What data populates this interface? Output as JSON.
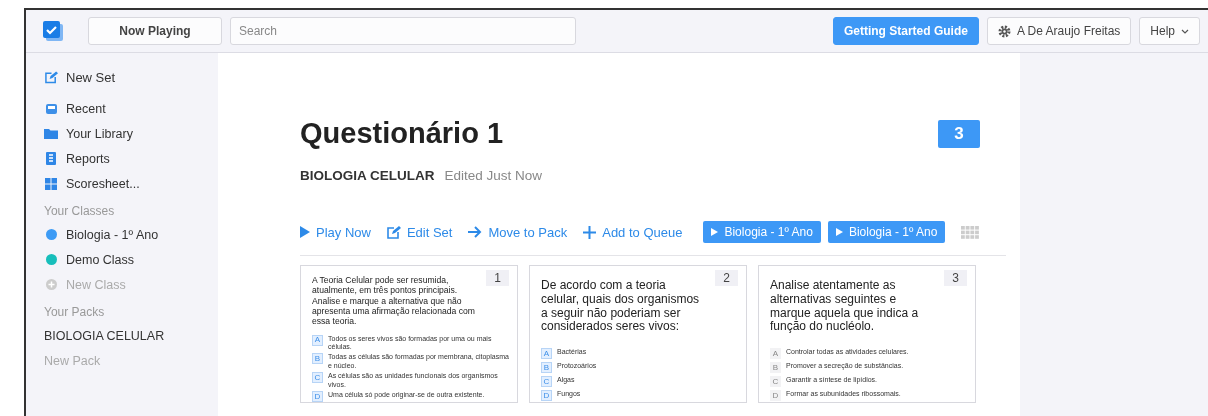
{
  "header": {
    "now_playing": "Now Playing",
    "search": {
      "placeholder": "Search"
    },
    "guide_button": "Getting Started Guide",
    "user": "A De Araujo Freitas",
    "help": "Help"
  },
  "sidebar": {
    "new_set": "New Set",
    "nav": [
      {
        "label": "Recent",
        "kind": "recent"
      },
      {
        "label": "Your Library",
        "kind": "library"
      },
      {
        "label": "Reports",
        "kind": "reports"
      },
      {
        "label": "Scoresheet...",
        "kind": "scoresheet"
      }
    ],
    "classes_heading": "Your Classes",
    "classes": [
      {
        "label": "Biologia - 1º Ano",
        "color": "#3d9bf5"
      },
      {
        "label": "Demo Class",
        "color": "#17bebb"
      }
    ],
    "new_class": "New Class",
    "packs_heading": "Your Packs",
    "packs": [
      "BIOLOGIA CELULAR"
    ],
    "new_pack": "New Pack"
  },
  "set": {
    "title": "Questionário 1",
    "count": "3",
    "pack": "BIOLOGIA CELULAR",
    "edited": "Edited Just Now",
    "actions": [
      {
        "label": "Play Now",
        "kind": "play"
      },
      {
        "label": "Edit Set",
        "kind": "edit"
      },
      {
        "label": "Move to Pack",
        "kind": "move"
      },
      {
        "label": "Add to Queue",
        "kind": "add"
      }
    ],
    "class_tags": [
      "Biologia - 1º Ano",
      "Biologia - 1º Ano"
    ],
    "questions": [
      {
        "number": "1",
        "kind": "blue",
        "text": "A Teoria Celular pode ser resumida, atualmente, em três pontos principais. Analise e marque a alternativa que não apresenta uma afirmação relacionada com essa teoria.",
        "answers": [
          {
            "letter": "A",
            "text": "Todos os seres vivos são formadas por uma ou mais células."
          },
          {
            "letter": "B",
            "text": "Todas as células são formadas por membrana, citoplasma e núcleo."
          },
          {
            "letter": "C",
            "text": "As células são as unidades funcionais dos organismos vivos."
          },
          {
            "letter": "D",
            "text": "Uma célula só pode originar-se de outra existente."
          }
        ]
      },
      {
        "number": "2",
        "kind": "blue",
        "text": "De acordo com a teoria celular, quais dos organismos a seguir não poderiam ser considerados seres vivos:",
        "answers": [
          {
            "letter": "A",
            "text": "Bactérias"
          },
          {
            "letter": "B",
            "text": "Protozoários"
          },
          {
            "letter": "C",
            "text": "Algas"
          },
          {
            "letter": "D",
            "text": "Fungos"
          }
        ]
      },
      {
        "number": "3",
        "kind": "grey",
        "text": "Analise atentamente as alternativas seguintes e marque aquela que indica a função do nucléolo.",
        "answers": [
          {
            "letter": "A",
            "text": "Controlar todas as atividades celulares."
          },
          {
            "letter": "B",
            "text": "Promover a secreção de substâncias."
          },
          {
            "letter": "C",
            "text": "Garantir a síntese de lipídios."
          },
          {
            "letter": "D",
            "text": "Formar as subunidades ribossomais."
          }
        ]
      }
    ]
  }
}
